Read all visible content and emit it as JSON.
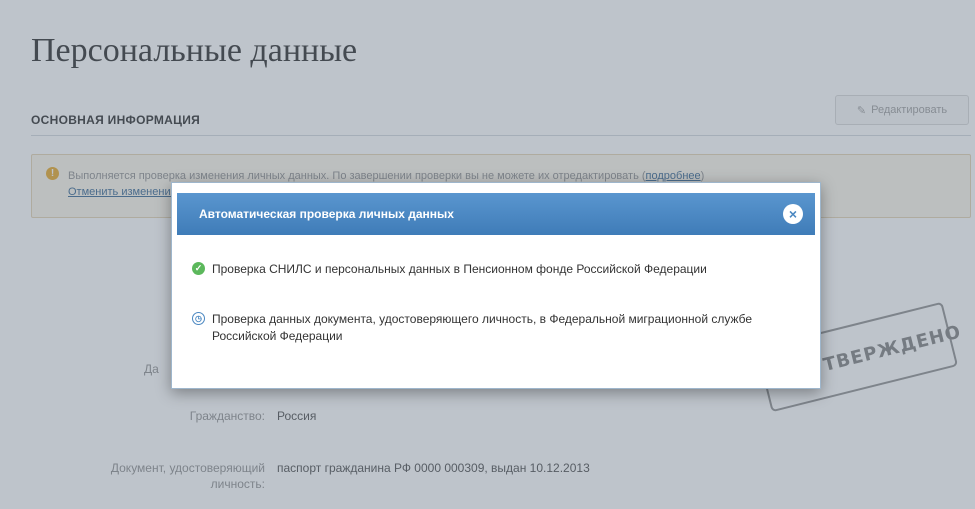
{
  "page": {
    "title": "Персональные данные",
    "section": "ОСНОВНАЯ ИНФОРМАЦИЯ",
    "edit_button": "Редактировать"
  },
  "warning": {
    "text": "Выполняется проверка изменения личных данных. По завершении проверки вы не можете их отредактировать",
    "details_link": "подробнее",
    "cancel_link": "Отменить изменения"
  },
  "fields": {
    "date_label_fragment": "Да",
    "citizenship_label": "Гражданство:",
    "citizenship_value": "Россия",
    "document_label_line1": "Документ, удостоверяющий",
    "document_label_line2": "личность:",
    "document_value": "паспорт гражданина РФ 0000 000309, выдан 10.12.2013"
  },
  "stamp": {
    "text": "УТВЕРЖДЕНО"
  },
  "modal": {
    "title": "Автоматическая проверка личных данных",
    "items": [
      {
        "status": "ok",
        "icon": "check-circle-icon",
        "text": "Проверка СНИЛС и персональных данных в Пенсионном фонде Российской Федерации"
      },
      {
        "status": "pending",
        "icon": "clock-icon",
        "text": "Проверка данных документа, удостоверяющего личность, в Федеральной миграционной службе Российской Федерации"
      }
    ]
  },
  "colors": {
    "header_blue": "#4a87c1",
    "ok_green": "#5cb85c",
    "warning_orange": "#e8a51c",
    "link_blue": "#2e5f8d"
  }
}
